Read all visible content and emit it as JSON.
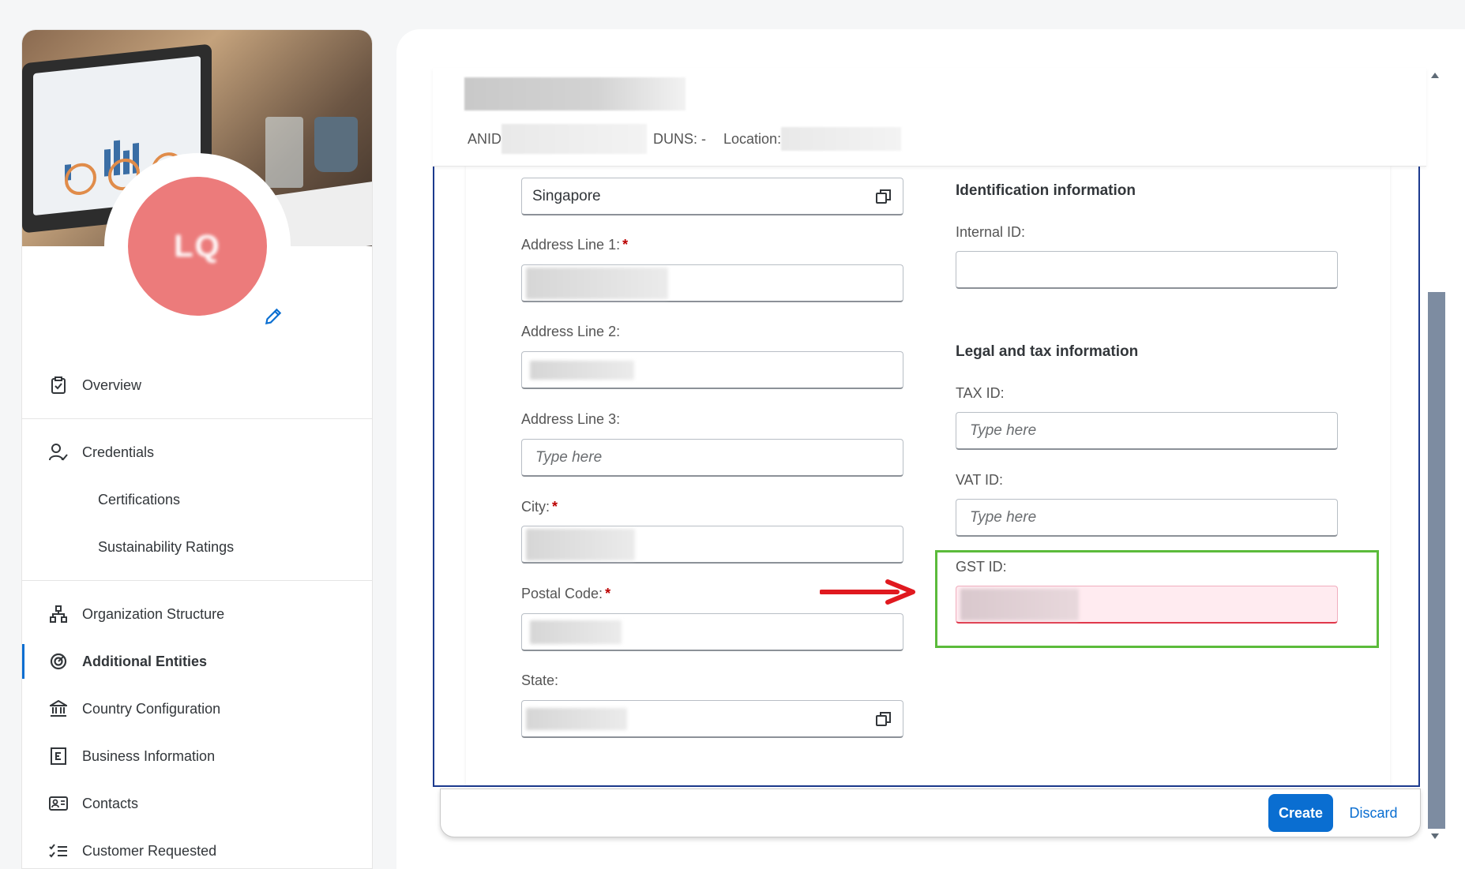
{
  "sidebar": {
    "items": [
      {
        "label": "Overview",
        "icon": "clipboard-check-icon"
      },
      {
        "label": "Credentials",
        "icon": "user-check-icon"
      },
      {
        "label": "Certifications"
      },
      {
        "label": "Sustainability Ratings"
      },
      {
        "label": "Organization Structure",
        "icon": "org-chart-icon"
      },
      {
        "label": "Additional Entities",
        "icon": "target-icon",
        "active": true
      },
      {
        "label": "Country Configuration",
        "icon": "bank-icon"
      },
      {
        "label": "Business Information",
        "icon": "building-card-icon"
      },
      {
        "label": "Contacts",
        "icon": "contact-card-icon"
      },
      {
        "label": "Customer Requested",
        "icon": "checklist-icon"
      }
    ]
  },
  "header": {
    "anid_label": "ANID",
    "duns_label": "DUNS: -",
    "location_label": "Location:"
  },
  "form": {
    "country_value": "Singapore",
    "address1_label": "Address Line 1:",
    "address2_label": "Address Line 2:",
    "address3_label": "Address Line 3:",
    "address3_placeholder": "Type here",
    "city_label": "City:",
    "postal_label": "Postal Code:",
    "state_label": "State:",
    "required_mark": "*",
    "identification_title": "Identification information",
    "internal_id_label": "Internal ID:",
    "legal_title": "Legal and tax information",
    "tax_id_label": "TAX ID:",
    "tax_id_placeholder": "Type here",
    "vat_id_label": "VAT ID:",
    "vat_id_placeholder": "Type here",
    "gst_id_label": "GST ID:"
  },
  "footer": {
    "create_label": "Create",
    "discard_label": "Discard"
  },
  "colors": {
    "accent": "#0a6ed1",
    "error_bg": "#ffebf0",
    "highlight": "#5bbb3b",
    "arrow": "#e0191f",
    "avatar": "#ec7b7b"
  }
}
